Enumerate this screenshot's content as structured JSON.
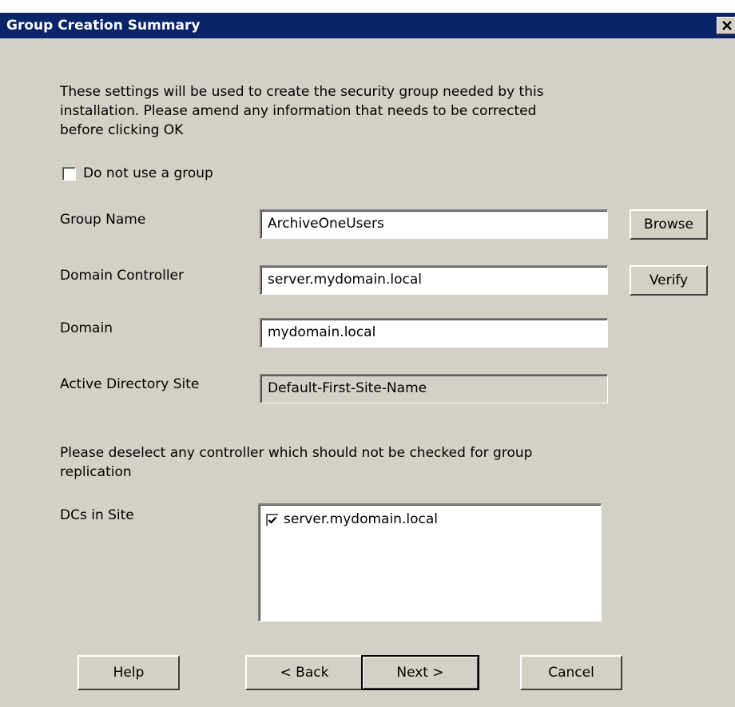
{
  "window": {
    "title": "Group Creation Summary",
    "close_icon": "close-icon",
    "title_bar_color": "#0a246a",
    "face_color": "#d4d0c8"
  },
  "intro": {
    "lines": [
      "These settings will be used to create the security group needed by this",
      "installation. Please amend any information that needs to be corrected",
      "before clicking OK"
    ]
  },
  "no_group": {
    "label": "Do not use a group",
    "checked": false
  },
  "fields": {
    "group_name": {
      "label": "Group Name",
      "value": "ArchiveOneUsers"
    },
    "domain_controller": {
      "label": "Domain Controller",
      "value": "server.mydomain.local"
    },
    "domain": {
      "label": "Domain",
      "value": "mydomain.local"
    },
    "ad_site": {
      "label": "Active Directory  Site",
      "value": "Default-First-Site-Name"
    }
  },
  "side_buttons": {
    "browse": "Browse",
    "verify": "Verify"
  },
  "deselect": {
    "lines": [
      "Please deselect any controller which should not be checked for group",
      "replication"
    ]
  },
  "dcs": {
    "label": "DCs in Site",
    "items": [
      {
        "label": "server.mydomain.local",
        "checked": true
      }
    ]
  },
  "footer": {
    "help": "Help",
    "back": "< Back",
    "next": "Next >",
    "cancel": "Cancel"
  }
}
